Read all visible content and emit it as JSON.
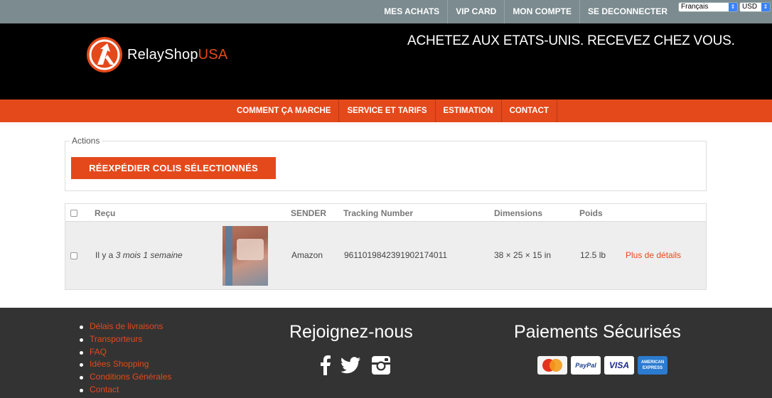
{
  "topbar": {
    "links": [
      "MES ACHATS",
      "VIP CARD",
      "MON COMPTE",
      "SE DECONNECTER"
    ],
    "language": "Français",
    "currency": "USD"
  },
  "header": {
    "logo_relay": "RelayShop",
    "logo_usa": "USA",
    "tagline": "ACHETEZ AUX ETATS-UNIS. RECEVEZ CHEZ VOUS."
  },
  "mainnav": [
    "COMMENT ÇA MARCHE",
    "SERVICE ET TARIFS",
    "ESTIMATION",
    "CONTACT"
  ],
  "actions": {
    "legend": "Actions",
    "button": "RÉEXPÉDIER COLIS SÉLECTIONNÉS"
  },
  "table": {
    "headers": {
      "received": "Reçu",
      "sender": "SENDER",
      "tracking": "Tracking Number",
      "dimensions": "Dimensions",
      "weight": "Poids"
    },
    "rows": [
      {
        "received_prefix": "Il y a",
        "received_ago": "3 mois 1 semaine",
        "sender": "Amazon",
        "tracking": "9611019842391902174011",
        "dimensions": "38 × 25 × 15 in",
        "weight": "12.5 lb",
        "details": "Plus de détails"
      }
    ]
  },
  "footer": {
    "links": [
      "Délais de livraisons",
      "Transporteurs",
      "FAQ",
      "Idées Shopping",
      "Conditions Générales",
      "Contact"
    ],
    "join_title": "Rejoignez-nous",
    "payment_title": "Paiements Sécurisés",
    "cards": [
      "MasterCard",
      "PayPal",
      "VISA",
      "AMERICAN EXPRESS"
    ]
  },
  "colors": {
    "accent": "#e4491b",
    "topbar": "#7b8b8f",
    "footer": "#333333"
  }
}
